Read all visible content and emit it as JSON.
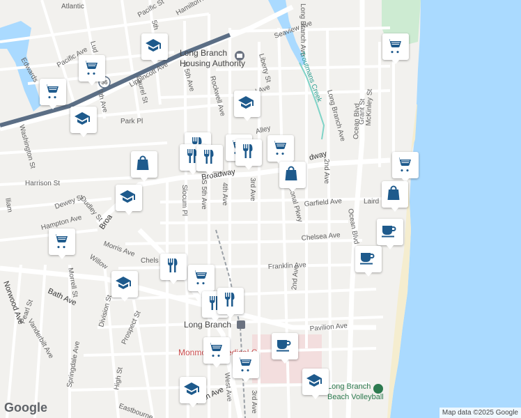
{
  "streets": {
    "atlantic": "Atlantic",
    "pacific_st": "Pacific St",
    "hamilton": "Hamilton Ave",
    "seaview": "Seaview Ave",
    "long_branch_ave_n": "Long Branch Ave",
    "long_branch_ave": "Long Branch Ave",
    "liberty": "Liberty St",
    "central": "Central Ave",
    "rockwell": "Rockwell Ave",
    "n5th": "N 5th Ave",
    "laurel": "Laurel St",
    "lippincott": "Lippincott Ave",
    "park_pl": "Park Pl",
    "washington": "Washington St",
    "edwards": "Edwards",
    "pacific_ave": "Pacific Ave",
    "ludlow": "Lud",
    "seventh": "7th Ave",
    "fifth_top": "5th",
    "harrison": "Harrison St",
    "dewey": "Dewey St",
    "dudley": "Dudley St",
    "hampton": "Hampton Ave",
    "broadway": "Broadway",
    "broadway_sw": "Broa",
    "broadway_e": "dway",
    "slocum": "Slocum Pl",
    "s5th": "S 5th Ave",
    "fourth": "4th Ave",
    "third": "3rd Ave",
    "third_s": "3rd Ave",
    "national": "National Pkwy",
    "garfield": "Garfield Ave",
    "laird": "Laird",
    "second": "2nd Ave",
    "second_s": "2nd Ave",
    "ocean_blvd": "Ocean Blvd",
    "ocean_blvd_s": "Ocean Blvd",
    "chelsea": "Chelsea Ave",
    "chelsea_w": "Chels",
    "morris": "Morris Ave",
    "willow": "Willow",
    "franklin": "Franklin Ave",
    "norwood": "Norwood Ave",
    "morrell": "Morrell St",
    "bath": "Bath Ave",
    "bath_s": "Bath Ave",
    "pearl": "Pearl St",
    "division": "Division St",
    "prospect": "Prospect St",
    "vanderbilt": "Vanderbilt Ave",
    "springdale": "Springdale Ave",
    "high": "High St",
    "eastbourne": "Eastbourne",
    "west_ave": "West Ave",
    "pavilion": "Pavilion Ave",
    "grant": "Grant St",
    "mckinley": "McKinley St",
    "alley": "Alley",
    "taylor": "lliam",
    "route": "36"
  },
  "places": {
    "housing_authority_line1": "Long Branch",
    "housing_authority_line2": "Housing Authority",
    "station": "Long Branch",
    "hospital": "Monmouth Medical C",
    "beach_volleyball_line1": "Long Branch",
    "beach_volleyball_line2": "Beach Volleyball",
    "creek": "Troutmans Creek"
  },
  "colors": {
    "marker_blue": "#1e5a8c",
    "water": "#aadaff",
    "road": "#ffffff",
    "creek": "#2a9d8f"
  },
  "markers": [
    {
      "icon": "school-icon",
      "label": "School"
    },
    {
      "icon": "grocery-cart-icon",
      "label": "Grocery"
    },
    {
      "icon": "grocery-cart-icon",
      "label": "Grocery"
    },
    {
      "icon": "grocery-cart-icon",
      "label": "Grocery"
    },
    {
      "icon": "school-icon",
      "label": "School"
    },
    {
      "icon": "grocery-cart-icon",
      "label": "Grocery"
    },
    {
      "icon": "school-icon",
      "label": "School"
    },
    {
      "icon": "shopping-bag-icon",
      "label": "Shopping"
    },
    {
      "icon": "restaurant-icon",
      "label": "Restaurant"
    },
    {
      "icon": "restaurant-icon",
      "label": "Restaurant"
    },
    {
      "icon": "restaurant-icon",
      "label": "Restaurant"
    },
    {
      "icon": "grocery-cart-icon",
      "label": "Grocery"
    },
    {
      "icon": "restaurant-icon",
      "label": "Restaurant"
    },
    {
      "icon": "shopping-bag-icon",
      "label": "Shopping"
    },
    {
      "icon": "school-icon",
      "label": "School"
    },
    {
      "icon": "grocery-cart-icon",
      "label": "Grocery"
    },
    {
      "icon": "grocery-cart-icon",
      "label": "Grocery"
    },
    {
      "icon": "shopping-bag-icon",
      "label": "Shopping"
    },
    {
      "icon": "cafe-icon",
      "label": "Cafe"
    },
    {
      "icon": "cafe-icon",
      "label": "Cafe"
    },
    {
      "icon": "restaurant-icon",
      "label": "Restaurant"
    },
    {
      "icon": "school-icon",
      "label": "School"
    },
    {
      "icon": "grocery-cart-icon",
      "label": "Grocery"
    },
    {
      "icon": "restaurant-icon",
      "label": "Restaurant"
    },
    {
      "icon": "restaurant-icon",
      "label": "Restaurant"
    },
    {
      "icon": "cafe-icon",
      "label": "Cafe"
    },
    {
      "icon": "grocery-cart-icon",
      "label": "Grocery"
    },
    {
      "icon": "grocery-cart-icon",
      "label": "Grocery"
    },
    {
      "icon": "school-icon",
      "label": "School"
    },
    {
      "icon": "school-icon",
      "label": "School"
    }
  ],
  "footer": {
    "logo": "Google",
    "attribution": "Map data ©2025 Google"
  }
}
